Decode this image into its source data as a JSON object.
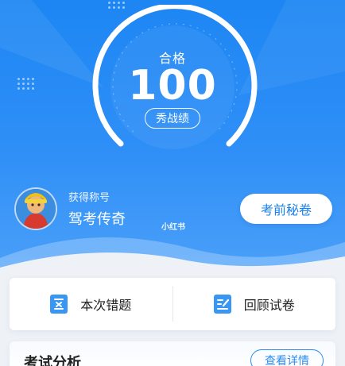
{
  "result": {
    "status_label": "合格",
    "score": "100",
    "show_button": "秀战绩"
  },
  "profile": {
    "title_caption": "获得称号",
    "title_name": "驾考传奇",
    "watermark": "小红书"
  },
  "buttons": {
    "secret_paper": "考前秘卷"
  },
  "actions": {
    "wrong_questions": "本次错题",
    "review_paper": "回顾试卷"
  },
  "analysis": {
    "title": "考试分析",
    "detail_button": "查看详情"
  },
  "colors": {
    "brand_blue": "#1d86f3",
    "accent_blue": "#2a8cf0",
    "white": "#ffffff"
  },
  "icons": {
    "wrong_questions": "wrong-questions-icon",
    "review_paper": "review-paper-icon",
    "avatar": "avatar-image"
  }
}
